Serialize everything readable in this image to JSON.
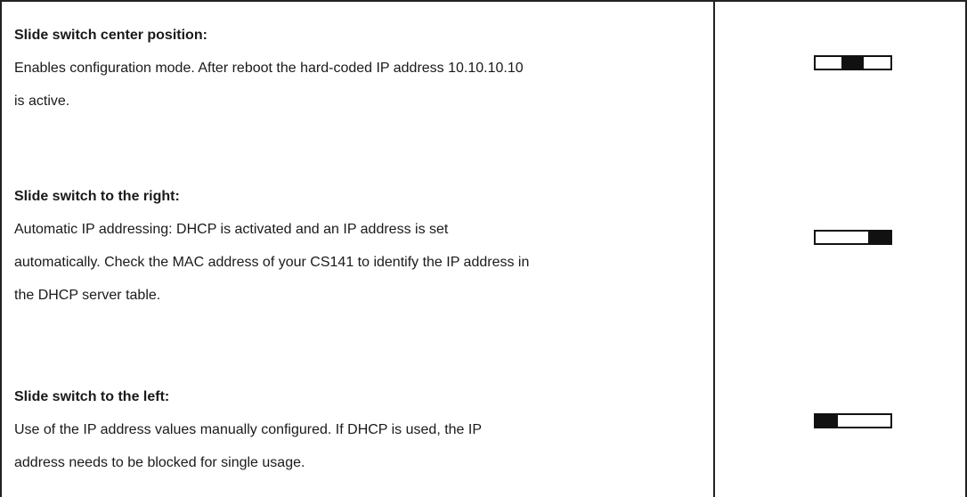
{
  "rows": [
    {
      "heading": "Slide switch center position:",
      "lines": [
        "Enables configuration mode. After reboot the hard-coded IP address 10.10.10.10",
        "is active."
      ],
      "switch_position": "center"
    },
    {
      "heading": "Slide switch to the right:",
      "lines": [
        "Automatic IP addressing: DHCP is activated and an IP address is set",
        "automatically. Check the MAC address of your CS141 to identify the IP address in",
        "the DHCP server table."
      ],
      "switch_position": "right"
    },
    {
      "heading": "Slide switch to the left:",
      "lines": [
        "Use of the IP address values manually configured. If DHCP is used, the IP",
        "address needs to be blocked for single usage."
      ],
      "switch_position": "left"
    }
  ]
}
